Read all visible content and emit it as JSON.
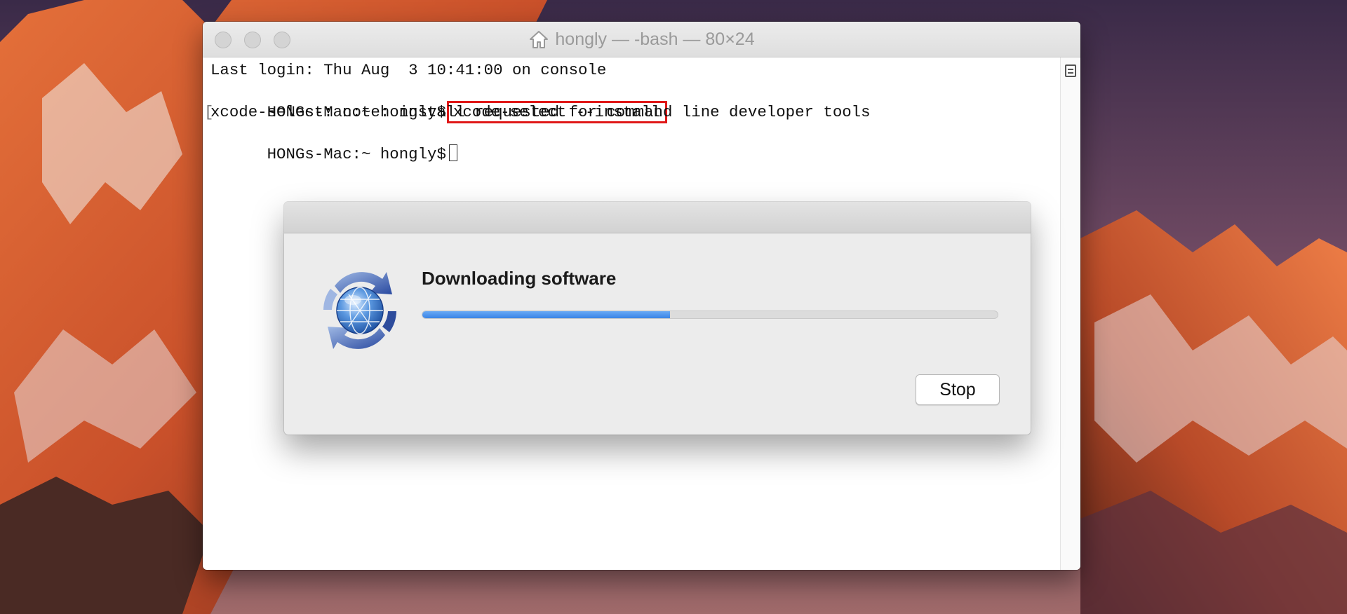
{
  "window": {
    "title": "hongly — -bash — 80×24",
    "title_icon": "home-icon"
  },
  "terminal": {
    "line1": "Last login: Thu Aug  3 10:41:00 on console",
    "prompt": "HONGs-Mac:~ hongly$",
    "command": "xcode-select --install",
    "line3": "xcode-select: note: install requested for command line developer tools",
    "prompt2": "HONGs-Mac:~ hongly$",
    "highlight_color": "#e01818"
  },
  "dialog": {
    "title": "Downloading software",
    "progress_percent": 43,
    "stop_label": "Stop",
    "icon": "software-update-globe-icon",
    "accent": "#3a84e6"
  }
}
